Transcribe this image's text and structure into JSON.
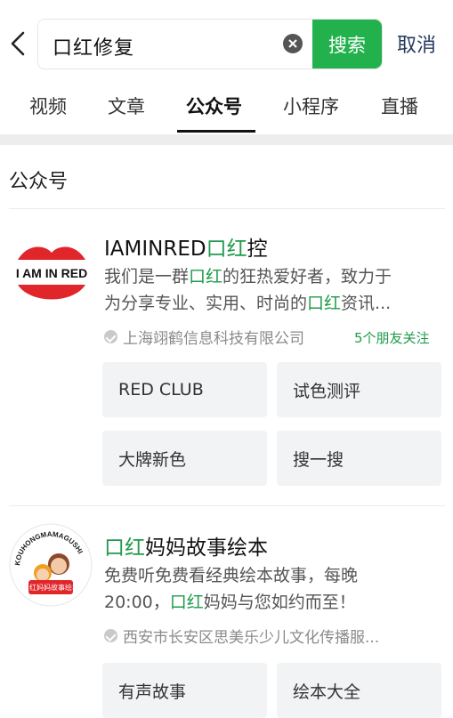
{
  "search": {
    "query": "口红修复",
    "search_button": "搜索",
    "cancel": "取消"
  },
  "tabs": [
    {
      "label": "视频"
    },
    {
      "label": "文章"
    },
    {
      "label": "公众号"
    },
    {
      "label": "小程序"
    },
    {
      "label": "直播"
    }
  ],
  "active_tab_index": 2,
  "section": {
    "title": "公众号"
  },
  "accounts": [
    {
      "name_prefix": "IAMINRED",
      "name_highlight": "口红",
      "name_suffix": "控",
      "avatar_text": "I AM IN RED",
      "desc_line1_pre": "我们是一群",
      "desc_line1_hl": "口红",
      "desc_line1_post": "的狂热爱好者，致力于",
      "desc_line2_pre": "为分享专业、实用、时尚的",
      "desc_line2_hl": "口红",
      "desc_line2_post": "资讯...",
      "company": "上海翊鹤信息科技有限公司",
      "friends": "5个朋友关注",
      "menu": [
        "RED CLUB",
        "试色测评",
        "大牌新色",
        "搜一搜"
      ]
    },
    {
      "name_highlight": "口红",
      "name_suffix": "妈妈故事绘本",
      "avatar_text": "KOUHONGMAMAGUSHI",
      "avatar_badge": "口红妈妈故事绘本",
      "desc_line1": "免费听免费看经典绘本故事，每晚",
      "desc_line2_pre": "20:00，",
      "desc_line2_hl": "口红",
      "desc_line2_post": "妈妈与您如约而至！",
      "company": "西安市长安区思美乐少儿文化传播服...",
      "menu": [
        "有声故事",
        "绘本大全"
      ]
    }
  ],
  "colors": {
    "accent": "#23b14d",
    "highlight": "#1e9b4a",
    "logo_red": "#e0252b"
  }
}
